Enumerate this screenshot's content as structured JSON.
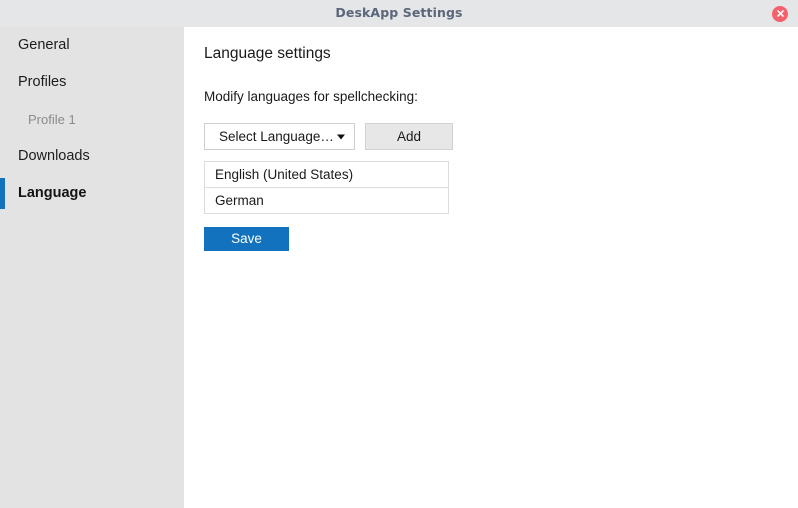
{
  "window": {
    "title": "DeskApp Settings",
    "close_icon": "close-circle-icon",
    "colors": {
      "titlebar_bg": "#e4e6e8",
      "titlebar_text": "#5c6679",
      "close_button": "#f4606c",
      "sidebar_bg": "#e3e3e3",
      "accent": "#1372bd",
      "content_bg": "#ffffff"
    }
  },
  "sidebar": {
    "items": [
      {
        "label": "General",
        "level": 0,
        "selected": false
      },
      {
        "label": "Profiles",
        "level": 0,
        "selected": false
      },
      {
        "label": "Profile 1",
        "level": 1,
        "selected": false
      },
      {
        "label": "Downloads",
        "level": 0,
        "selected": false
      },
      {
        "label": "Language",
        "level": 0,
        "selected": true
      }
    ]
  },
  "main": {
    "title": "Language settings",
    "instruction": "Modify languages for spellchecking:",
    "select": {
      "value": "Select Language…",
      "arrow_icon": "chevron-down-icon"
    },
    "add_button": "Add",
    "languages": [
      "English (United States)",
      "German"
    ],
    "save_button": "Save"
  }
}
